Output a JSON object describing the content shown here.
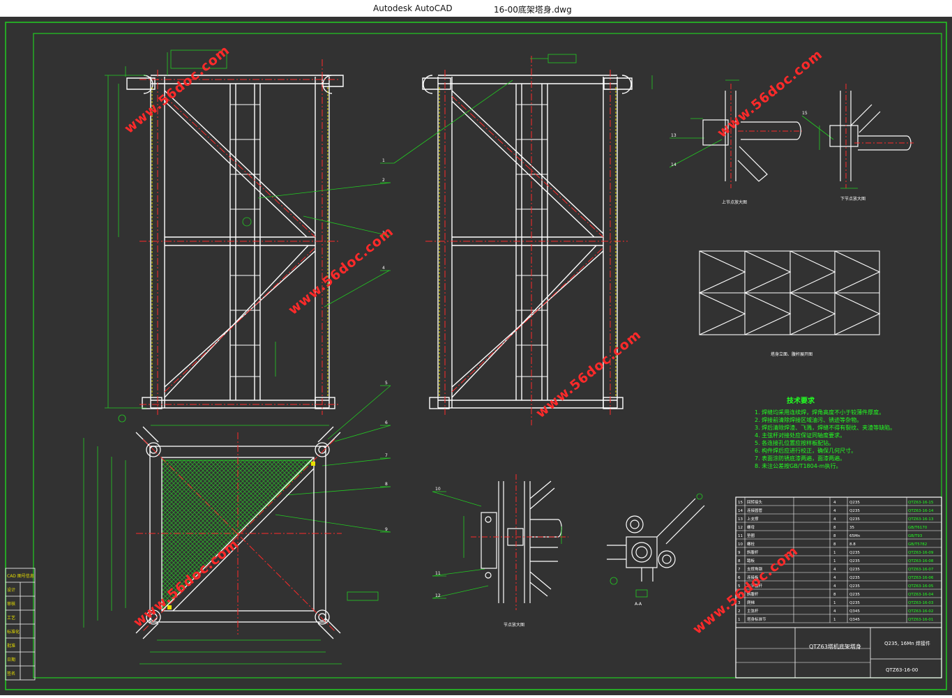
{
  "window": {
    "app_title": "Autodesk AutoCAD",
    "file_title": "16-00底架塔身.dwg"
  },
  "watermark": "www.56doc.com",
  "colors": {
    "background": "#323232",
    "drawing_lines": "#ffffff",
    "border_green": "#22cc22",
    "center_red": "#ff2a2a",
    "hatch_green": "#1a8a1a",
    "yellow": "#e8e000"
  },
  "callouts": [
    "1",
    "2",
    "3",
    "4",
    "5",
    "6",
    "7",
    "8",
    "9",
    "10",
    "11",
    "12",
    "13",
    "14",
    "15"
  ],
  "title_block": {
    "parts": [
      {
        "no": "15",
        "name": "回转接头",
        "qty": "4",
        "material": "Q235",
        "code": "QTZ63-16-15"
      },
      {
        "no": "14",
        "name": "连接圆管",
        "qty": "4",
        "material": "Q235",
        "code": "QTZ63-16-14"
      },
      {
        "no": "13",
        "name": "上支撑",
        "qty": "4",
        "material": "Q235",
        "code": "QTZ63-16-13"
      },
      {
        "no": "12",
        "name": "螺母",
        "qty": "8",
        "material": "35",
        "code": "GB/T6170"
      },
      {
        "no": "11",
        "name": "垫圈",
        "qty": "8",
        "material": "65Mn",
        "code": "GB/T93"
      },
      {
        "no": "10",
        "name": "螺栓",
        "qty": "8",
        "material": "8.8",
        "code": "GB/T5782"
      },
      {
        "no": "9",
        "name": "斜腹杆",
        "qty": "1",
        "material": "Q235",
        "code": "QTZ63-16-09"
      },
      {
        "no": "8",
        "name": "踏板",
        "qty": "1",
        "material": "Q235",
        "code": "QTZ63-16-08"
      },
      {
        "no": "7",
        "name": "支撑角钢",
        "qty": "4",
        "material": "Q235",
        "code": "QTZ63-16-07"
      },
      {
        "no": "6",
        "name": "连接板",
        "qty": "4",
        "material": "Q235",
        "code": "QTZ63-16-06"
      },
      {
        "no": "5",
        "name": "水平腹杆",
        "qty": "4",
        "material": "Q235",
        "code": "QTZ63-16-05"
      },
      {
        "no": "4",
        "name": "斜腹杆",
        "qty": "8",
        "material": "Q235",
        "code": "QTZ63-16-04"
      },
      {
        "no": "3",
        "name": "爬梯",
        "qty": "1",
        "material": "Q235",
        "code": "QTZ63-16-03"
      },
      {
        "no": "2",
        "name": "主弦杆",
        "qty": "4",
        "material": "Q345",
        "code": "QTZ63-16-02"
      },
      {
        "no": "1",
        "name": "塔身标准节",
        "qty": "1",
        "material": "Q345",
        "code": "QTZ63-16-01"
      }
    ],
    "drawing_title": "QTZ63塔机底架塔身",
    "material_note": "Q235, 16Mn 焊接件",
    "drawing_no": "QTZ63-16-00"
  },
  "tech_requirements": {
    "title": "技术要求",
    "items": [
      "1. 焊缝均采用连续焊，焊角高度不小于较薄件厚度。",
      "2. 焊接前清除焊接区域油污、锈迹等杂物。",
      "3. 焊后清除焊渣、飞溅，焊缝不得有裂纹、夹渣等缺陷。",
      "4. 主弦杆对接处应保证同轴度要求。",
      "5. 各连接孔位置应按样板配钻。",
      "6. 构件焊后应进行校正，确保几何尺寸。",
      "7. 表面涂防锈底漆两遍，面漆两遍。",
      "8. 未注公差按GB/T1804-m执行。"
    ]
  },
  "view_titles": {
    "detail_a": "上节点放大图",
    "detail_b": "下节点放大图",
    "truss": "塔身立面、腹杆展开图",
    "joint": "节点放大图",
    "section": "A-A"
  },
  "side_block": [
    "CAD 图号信息",
    "设计",
    "审核",
    "工艺",
    "标准化",
    "批准",
    "日期",
    "签名"
  ]
}
